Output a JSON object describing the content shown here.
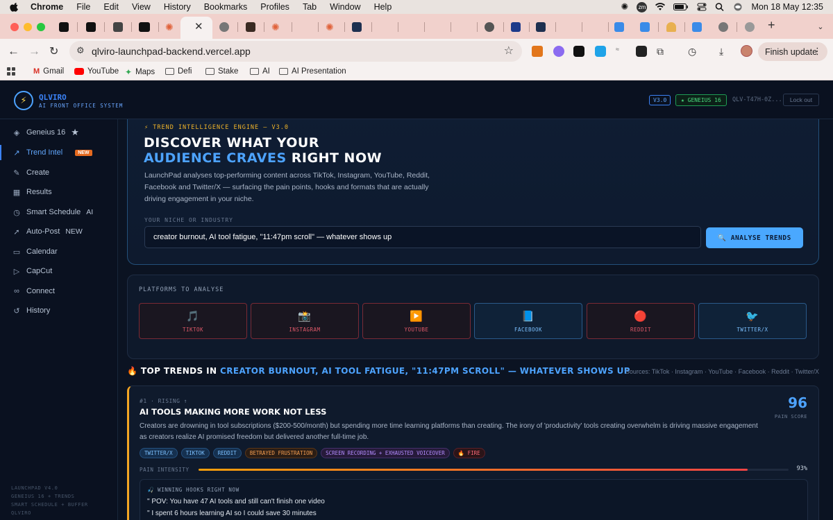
{
  "menubar": {
    "app": "Chrome",
    "items": [
      "File",
      "Edit",
      "View",
      "History",
      "Bookmarks",
      "Profiles",
      "Tab",
      "Window",
      "Help"
    ],
    "zoom_icon": "zm",
    "datetime": "Mon 18 May  12:35"
  },
  "browser": {
    "url": "qlviro-launchpad-backend.vercel.app",
    "finish_update": "Finish update",
    "bookmarks": [
      "Gmail",
      "YouTube",
      "Maps",
      "Defi",
      "Stake",
      "AI",
      "AI Presentation"
    ]
  },
  "header": {
    "brand": "QLVIRO",
    "subtitle": "AI FRONT OFFICE SYSTEM",
    "version_badge": "V3.0",
    "geneius_badge": "★ GENEIUS 16",
    "license": "QLV-T47H-0Z...",
    "lockout": "Lock out"
  },
  "sidebar": {
    "items": [
      {
        "label": "Geneius 16",
        "icon": "layers-icon",
        "suffix": "★"
      },
      {
        "label": "Trend Intel",
        "icon": "trend-icon",
        "badge": "NEW",
        "active": true
      },
      {
        "label": "Create",
        "icon": "pencil-icon"
      },
      {
        "label": "Results",
        "icon": "grid-icon"
      },
      {
        "label": "Smart Schedule",
        "icon": "clock-icon",
        "suffix": "AI"
      },
      {
        "label": "Auto-Post",
        "icon": "rocket-icon",
        "suffix": "NEW"
      },
      {
        "label": "Calendar",
        "icon": "calendar-icon"
      },
      {
        "label": "CapCut",
        "icon": "video-icon"
      },
      {
        "label": "Connect",
        "icon": "link-icon"
      },
      {
        "label": "History",
        "icon": "history-icon"
      }
    ],
    "footer": [
      "LAUNCHPAD V4.0",
      "GENEIUS 16 + TRENDS",
      "SMART SCHEDULE + BUFFER",
      "QLVIRO"
    ]
  },
  "hero": {
    "engine": "⚡ TREND INTELLIGENCE ENGINE — V3.0",
    "title_line1": "DISCOVER WHAT YOUR",
    "title_highlight": "AUDIENCE CRAVES",
    "title_rest": " RIGHT NOW",
    "description": "LaunchPad analyses top-performing content across TikTok, Instagram, YouTube, Reddit, Facebook and Twitter/X — surfacing the pain points, hooks and formats that are actually driving engagement in your niche.",
    "niche_label": "YOUR NICHE OR INDUSTRY",
    "niche_value": "creator burnout, AI tool fatigue, \"11:47pm scroll\" — whatever shows up",
    "analyse_button": "🔍 ANALYSE TRENDS"
  },
  "platforms": {
    "label": "PLATFORMS TO ANALYSE",
    "items": [
      {
        "name": "TIKTOK",
        "icon": "🎵",
        "style": "red"
      },
      {
        "name": "INSTAGRAM",
        "icon": "📸",
        "style": "red"
      },
      {
        "name": "YOUTUBE",
        "icon": "▶️",
        "style": "red"
      },
      {
        "name": "FACEBOOK",
        "icon": "📘",
        "style": "blue"
      },
      {
        "name": "REDDIT",
        "icon": "🔴",
        "style": "red"
      },
      {
        "name": "TWITTER/X",
        "icon": "🐦",
        "style": "blue"
      }
    ]
  },
  "trends": {
    "heading_prefix": "🔥 TOP TRENDS IN ",
    "heading_niche": "CREATOR BURNOUT, AI TOOL FATIGUE, \"11:47PM SCROLL\" — WHATEVER SHOWS UP",
    "sources": "Sources: TikTok · Instagram · YouTube · Facebook · Reddit · Twitter/X",
    "items": [
      {
        "rank": "#1 · RISING ↑",
        "title": "AI TOOLS MAKING MORE WORK NOT LESS",
        "description": "Creators are drowning in tool subscriptions ($200-500/month) but spending more time learning platforms than creating. The irony of 'productivity' tools creating overwhelm is driving massive engagement as creators realize AI promised freedom but delivered another full-time job.",
        "score": "96",
        "score_label": "PAIN SCORE",
        "tags": [
          {
            "text": "TWITTER/X",
            "style": "b"
          },
          {
            "text": "TIKTOK",
            "style": "b"
          },
          {
            "text": "REDDIT",
            "style": "b"
          },
          {
            "text": "BETRAYED FRUSTRATION",
            "style": "o"
          },
          {
            "text": "SCREEN RECORDING + EXHAUSTED VOICEOVER",
            "style": "p"
          },
          {
            "text": "🔥 FIRE",
            "style": "r"
          }
        ],
        "pain_label": "PAIN INTENSITY",
        "pain_value": 93,
        "pain_text": "93%",
        "hooks_label": "🎣 WINNING HOOKS RIGHT NOW",
        "hooks": [
          "\" POV: You have 47 AI tools and still can't finish one video",
          "\" I spent 6 hours learning AI so I could save 30 minutes"
        ]
      }
    ]
  },
  "colors": {
    "accent": "#4da3ff",
    "background": "#0b1322",
    "warning": "#f5a623"
  }
}
